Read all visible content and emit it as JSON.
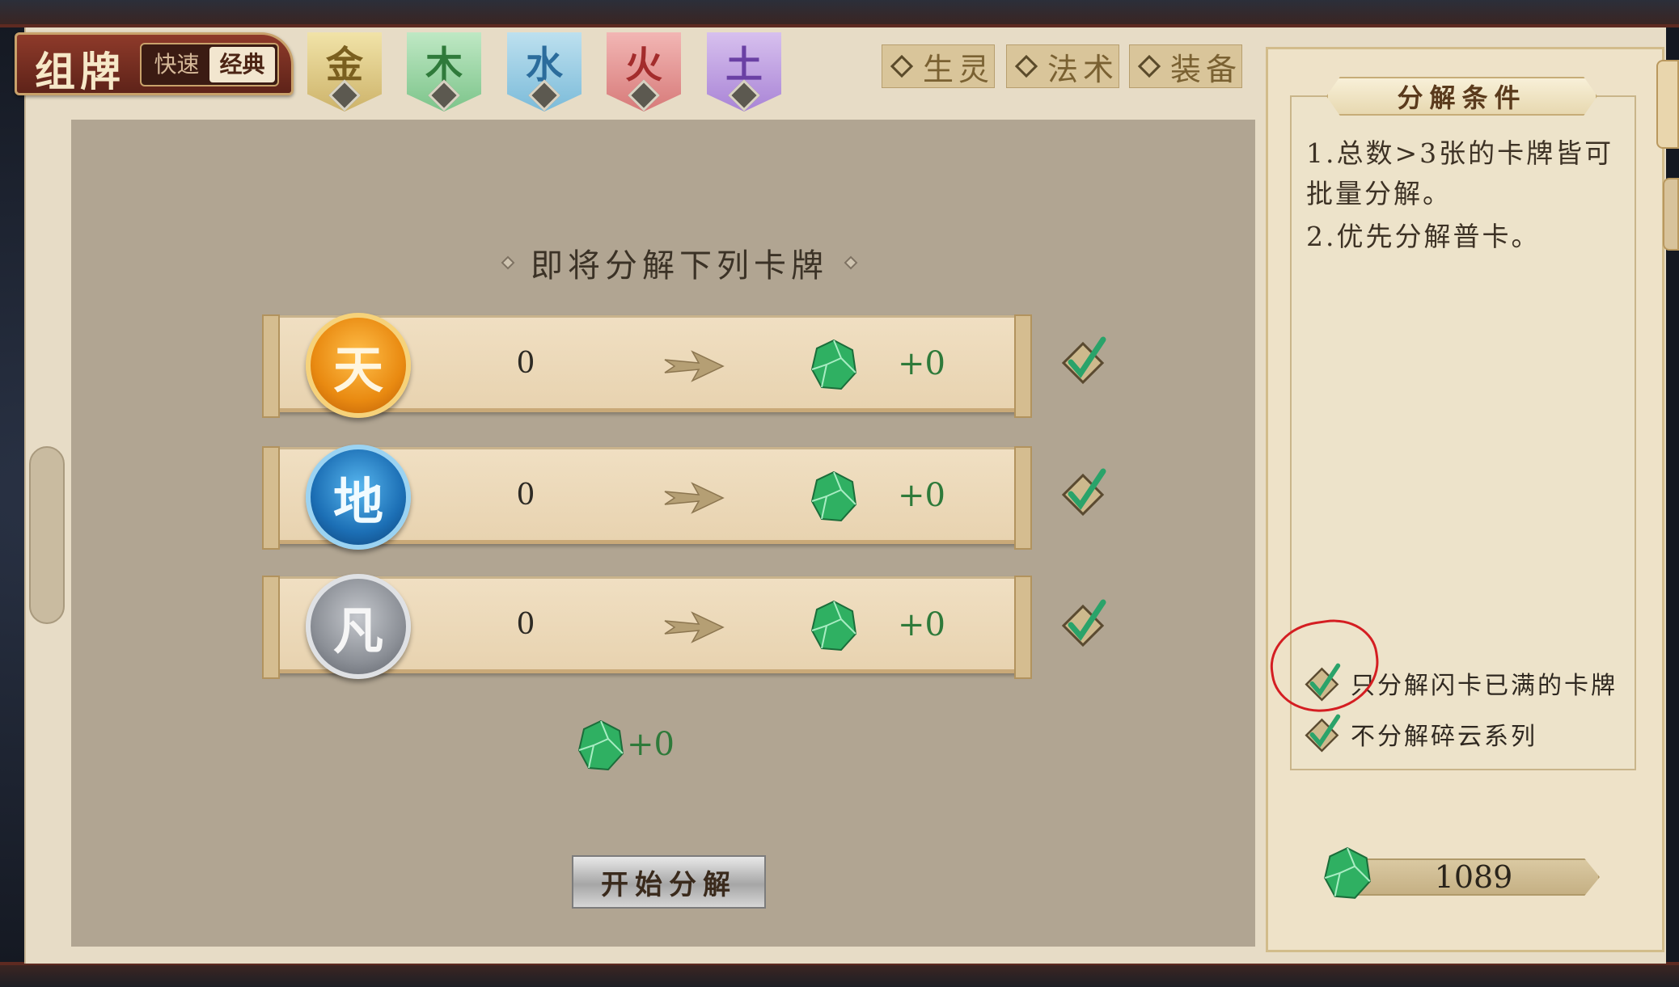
{
  "header": {
    "title": "组牌",
    "modes": [
      "快速",
      "经典"
    ],
    "active_mode": "经典"
  },
  "element_tabs": [
    {
      "label": "金",
      "color": "#d8c27e"
    },
    {
      "label": "木",
      "color": "#8fcd9a"
    },
    {
      "label": "水",
      "color": "#8fc7e0"
    },
    {
      "label": "火",
      "color": "#e08f8e"
    },
    {
      "label": "土",
      "color": "#b595dd"
    }
  ],
  "type_filters": [
    "生灵",
    "法术",
    "装备"
  ],
  "main": {
    "heading": "即将分解下列卡牌",
    "rows": [
      {
        "rarity": "天",
        "count": "0",
        "gain": "+0",
        "checked": true
      },
      {
        "rarity": "地",
        "count": "0",
        "gain": "+0",
        "checked": true
      },
      {
        "rarity": "凡",
        "count": "0",
        "gain": "+0",
        "checked": true
      }
    ],
    "total_gain": "+0",
    "start_button": "开始分解"
  },
  "side_panel": {
    "title": "分解条件",
    "rules": [
      "1.总数>3张的卡牌皆可批量分解。",
      "2.优先分解普卡。"
    ],
    "options": [
      {
        "label": "只分解闪卡已满的卡牌",
        "checked": true
      },
      {
        "label": "不分解碎云系列",
        "checked": true
      }
    ],
    "balance": "1089"
  },
  "colors": {
    "gain_green": "#2e7a3a",
    "check_green": "#2aa36a",
    "annotation_red": "#d41e22",
    "title_plate": "#8e3a2a"
  }
}
